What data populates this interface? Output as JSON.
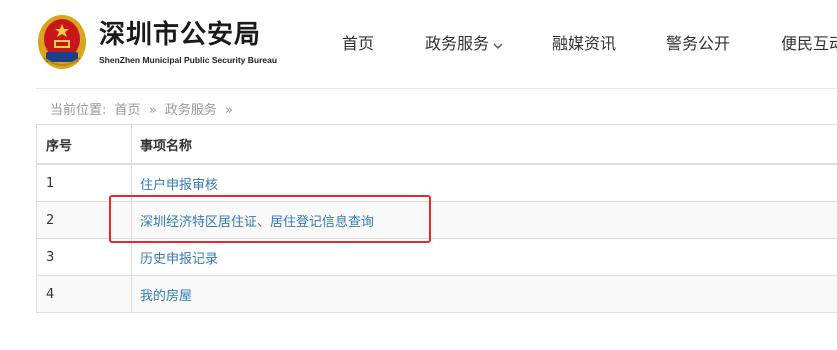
{
  "header": {
    "title": "深圳市公安局",
    "subtitle": "ShenZhen Municipal Public Security Bureau",
    "emblem_icon": "police-emblem-icon",
    "nav": [
      {
        "label": "首页"
      },
      {
        "label": "政务服务",
        "has_dropdown": true
      },
      {
        "label": "融媒资讯"
      },
      {
        "label": "警务公开"
      },
      {
        "label": "便民互动"
      }
    ]
  },
  "breadcrumb": {
    "prefix": "当前位置:",
    "items": [
      "首页",
      "政务服务"
    ],
    "separator": "»"
  },
  "table": {
    "columns": [
      "序号",
      "事项名称"
    ],
    "rows": [
      {
        "num": "1",
        "name": "住户申报审核"
      },
      {
        "num": "2",
        "name": "深圳经济特区居住证、居住登记信息查询"
      },
      {
        "num": "3",
        "name": "历史申报记录"
      },
      {
        "num": "4",
        "name": "我的房屋"
      }
    ]
  },
  "colors": {
    "link": "#337ab7",
    "highlight_border": "#e32b2b",
    "emblem_red": "#c8161d",
    "emblem_gold": "#d9a520"
  }
}
